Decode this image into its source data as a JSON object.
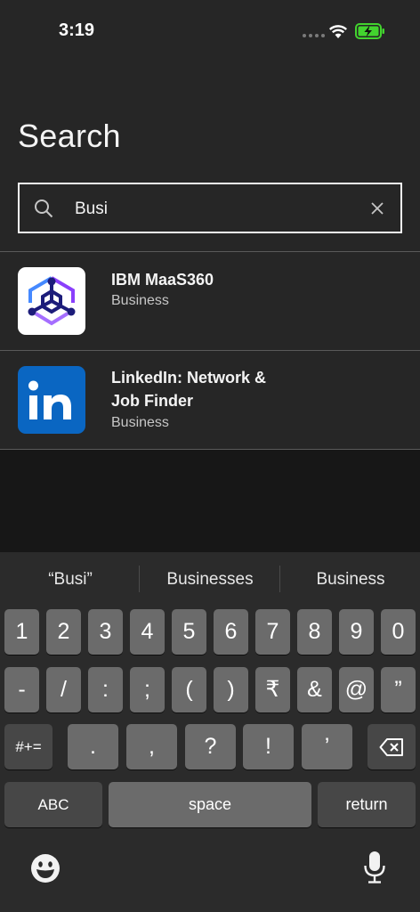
{
  "status": {
    "time": "3:19"
  },
  "page": {
    "title": "Search"
  },
  "search": {
    "value": "Busi"
  },
  "results": [
    {
      "name": "IBM MaaS360",
      "category": "Business"
    },
    {
      "name": "LinkedIn: Network & Job Finder",
      "category": "Business"
    }
  ],
  "keyboard": {
    "suggestions": [
      "“Busi”",
      "Businesses",
      "Business"
    ],
    "row1": [
      "1",
      "2",
      "3",
      "4",
      "5",
      "6",
      "7",
      "8",
      "9",
      "0"
    ],
    "row2": [
      "-",
      "/",
      ":",
      ";",
      "(",
      ")",
      "₹",
      "&",
      "@",
      "”"
    ],
    "row3": [
      ".",
      ",",
      "?",
      "!",
      "’"
    ],
    "symbols_label": "#+=",
    "abc_label": "ABC",
    "space_label": "space",
    "return_label": "return"
  },
  "colors": {
    "linkedin_blue": "#0a66c2",
    "ibm_purple": "#8a3ffc",
    "ibm_navy": "#1c1c7a"
  }
}
